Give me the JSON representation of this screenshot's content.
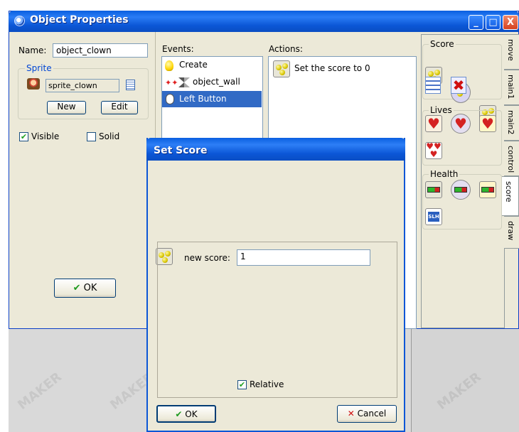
{
  "window": {
    "title": "Object Properties",
    "minimize": "_",
    "maximize": "□",
    "close": "X"
  },
  "props": {
    "name_label": "Name:",
    "name_value": "object_clown",
    "sprite_group": "Sprite",
    "sprite_value": "sprite_clown",
    "new_label": "New",
    "edit_label": "Edit",
    "visible_label": "Visible",
    "visible_checked": true,
    "solid_label": "Solid",
    "solid_checked": false,
    "ok_label": "OK"
  },
  "events": {
    "header": "Events:",
    "items": [
      "Create",
      "object_wall",
      "Left Button"
    ],
    "selected": 2
  },
  "actions": {
    "header": "Actions:",
    "items": [
      "Set the score to 0"
    ]
  },
  "palette": {
    "sections": [
      "Score",
      "Lives",
      "Health"
    ],
    "tabs": [
      "move",
      "main1",
      "main2",
      "control",
      "score",
      "draw"
    ],
    "active_tab": "score"
  },
  "dialog": {
    "title": "Set Score",
    "new_score_label": "new score:",
    "new_score_value": "1",
    "relative_label": "Relative",
    "relative_checked": true,
    "ok_label": "OK",
    "cancel_label": "Cancel"
  },
  "watermark": "MAKER"
}
